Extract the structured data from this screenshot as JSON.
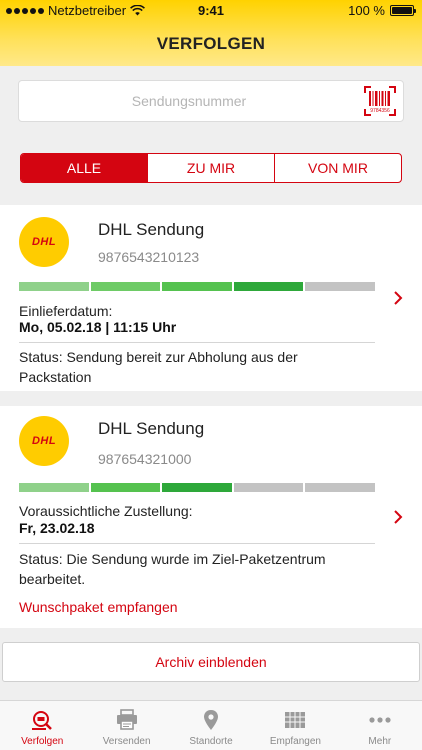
{
  "status_bar": {
    "carrier": "Netzbetreiber",
    "time": "9:41",
    "battery": "100 %"
  },
  "header": {
    "title": "VERFOLGEN"
  },
  "search": {
    "placeholder": "Sendungsnummer",
    "scan_icon": "barcode-scan-icon",
    "scan_digits": "9784356"
  },
  "filter": {
    "tabs": [
      {
        "label": "ALLE",
        "active": true
      },
      {
        "label": "ZU MIR"
      },
      {
        "label": "VON MIR"
      }
    ]
  },
  "shipments": [
    {
      "logo": "DHL",
      "title": "DHL Sendung",
      "number": "9876543210123",
      "progress_completed_segments": 4,
      "progress_total_segments": 5,
      "date_label": "Einlieferdatum:",
      "date_value": "Mo, 05.02.18 | 11:15 Uhr",
      "status": "Status: Sendung bereit zur Abholung aus der Packstation"
    },
    {
      "logo": "DHL",
      "title": "DHL Sendung",
      "number": "987654321000",
      "progress_completed_segments": 3,
      "progress_total_segments": 5,
      "date_label": "Voraussichtliche Zustellung:",
      "date_value": "Fr, 23.02.18",
      "status": "Status: Die Sendung wurde im Ziel-Paketzentrum bearbeitet.",
      "link": "Wunschpaket empfangen"
    }
  ],
  "archive_button": "Archiv einblenden",
  "tabbar": [
    {
      "label": "Verfolgen",
      "icon": "track-icon",
      "active": true
    },
    {
      "label": "Versenden",
      "icon": "printer-icon"
    },
    {
      "label": "Standorte",
      "icon": "location-pin-icon"
    },
    {
      "label": "Empfangen",
      "icon": "parcel-locker-icon"
    },
    {
      "label": "Mehr",
      "icon": "more-dots-icon"
    }
  ],
  "colors": {
    "brand_yellow": "#ffcc00",
    "brand_red": "#d40511",
    "progress_light": "#8fd18a",
    "progress_medium": "#55c24f",
    "progress_dark": "#2ea83a",
    "progress_empty": "#c3c3c3"
  }
}
